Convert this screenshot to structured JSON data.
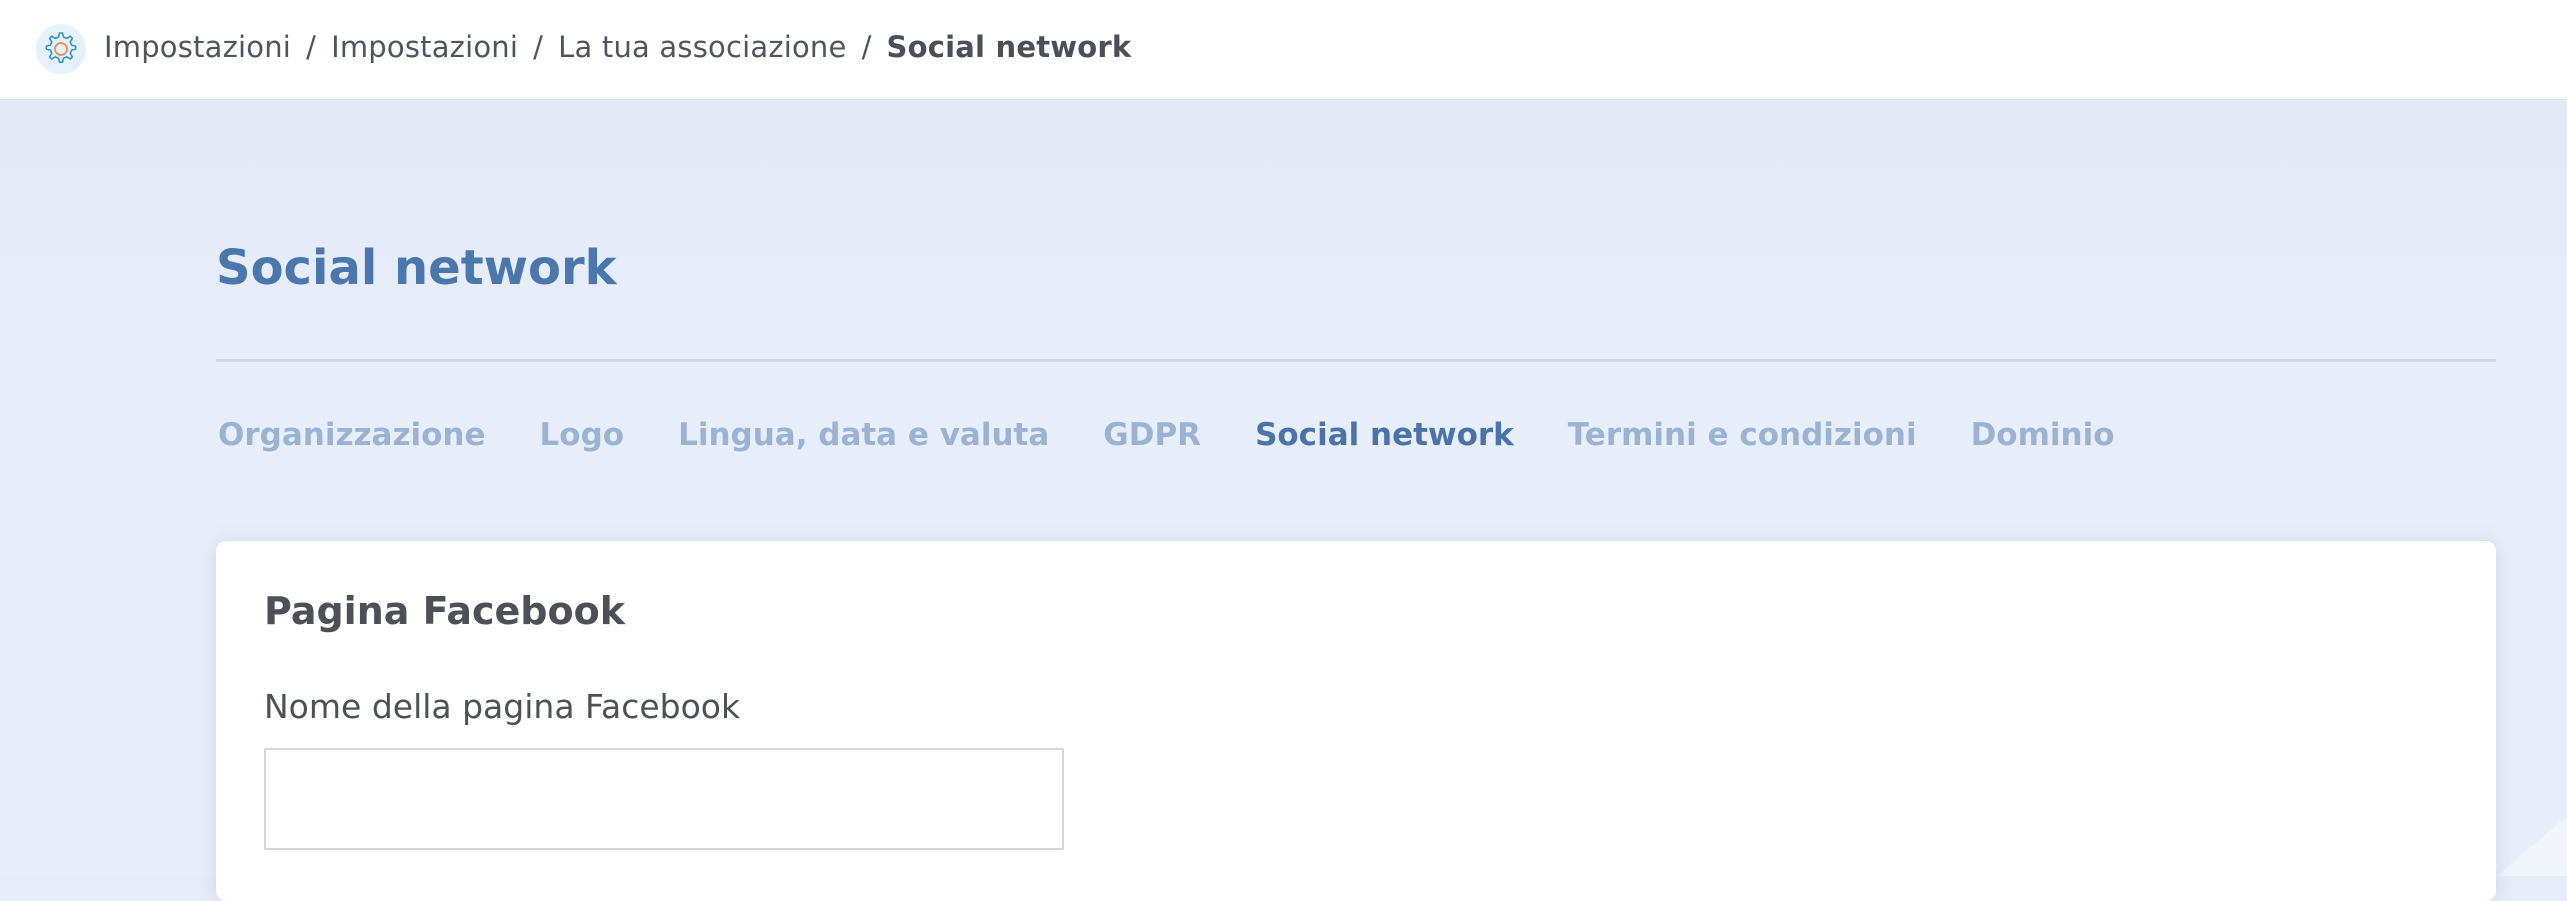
{
  "breadcrumb": {
    "items": [
      "Impostazioni",
      "Impostazioni",
      "La tua associazione"
    ],
    "current": "Social network",
    "separator": "/"
  },
  "icons": {
    "settings": "gear-icon"
  },
  "page": {
    "title": "Social network"
  },
  "tabs": [
    {
      "label": "Organizzazione",
      "active": false
    },
    {
      "label": "Logo",
      "active": false
    },
    {
      "label": "Lingua, data e valuta",
      "active": false
    },
    {
      "label": "GDPR",
      "active": false
    },
    {
      "label": "Social network",
      "active": true
    },
    {
      "label": "Termini e condizioni",
      "active": false
    },
    {
      "label": "Dominio",
      "active": false
    }
  ],
  "card": {
    "title": "Pagina Facebook",
    "field_label": "Nome della pagina Facebook",
    "field_value": "",
    "field_placeholder": ""
  },
  "colors": {
    "accent": "#4a78ad",
    "tab_inactive": "#9ab3d3",
    "background": "#e6ecf8"
  }
}
